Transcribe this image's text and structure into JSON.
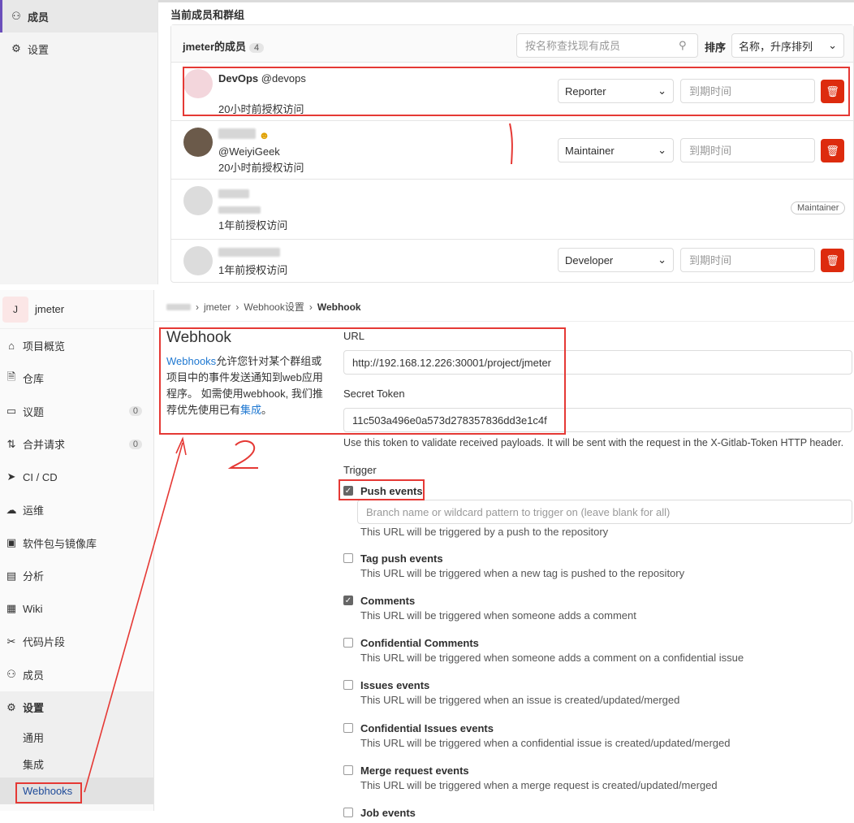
{
  "top_sidebar": {
    "items": [
      {
        "label": "成员",
        "icon": "users-icon",
        "active": true
      },
      {
        "label": "设置",
        "icon": "gear-icon",
        "active": false
      }
    ]
  },
  "members": {
    "section_title": "当前成员和群组",
    "header_title": "jmeter的成员",
    "count": "4",
    "search_placeholder": "按名称查找现有成员",
    "sort_label": "排序",
    "sort_value": "名称，升序排列",
    "expire_placeholder": "到期时间",
    "rows": [
      {
        "name": "DevOps",
        "handle": "@devops",
        "granted": "20小时前授权访问",
        "role": "Reporter"
      },
      {
        "name": "",
        "handle": "@WeiyiGeek",
        "granted": "20小时前授权访问",
        "role": "Maintainer"
      },
      {
        "name": "",
        "handle": "",
        "granted": "1年前授权访问",
        "role": "Maintainer"
      },
      {
        "name": "",
        "handle": "",
        "granted": "1年前授权访问",
        "role": "Developer"
      }
    ]
  },
  "project": {
    "avatar_letter": "J",
    "name": "jmeter"
  },
  "sidebar": {
    "items": [
      {
        "label": "项目概览",
        "icon": "home-icon"
      },
      {
        "label": "仓库",
        "icon": "document-icon"
      },
      {
        "label": "议题",
        "icon": "issues-icon",
        "badge": "0"
      },
      {
        "label": "合并请求",
        "icon": "merge-request-icon",
        "badge": "0"
      },
      {
        "label": "CI / CD",
        "icon": "rocket-icon"
      },
      {
        "label": "运维",
        "icon": "cloud-icon"
      },
      {
        "label": "软件包与镜像库",
        "icon": "package-icon"
      },
      {
        "label": "分析",
        "icon": "chart-icon"
      },
      {
        "label": "Wiki",
        "icon": "book-icon"
      },
      {
        "label": "代码片段",
        "icon": "scissors-icon"
      },
      {
        "label": "成员",
        "icon": "users-icon"
      },
      {
        "label": "设置",
        "icon": "gear-icon",
        "active": true
      }
    ],
    "settings_sub": [
      {
        "label": "通用"
      },
      {
        "label": "集成"
      },
      {
        "label": "Webhooks",
        "active": true
      }
    ]
  },
  "breadcrumb": {
    "items": [
      "jmeter",
      "Webhook设置"
    ],
    "current": "Webhook"
  },
  "webhook": {
    "title": "Webhook",
    "desc_link": "Webhooks",
    "desc_text": "允许您针对某个群组或项目中的事件发送通知到web应用程序。 如需使用webhook, 我们推荐优先使用已有",
    "desc_link2": "集成",
    "desc_end": "。",
    "url_label": "URL",
    "url_value": "http://192.168.12.226:30001/project/jmeter",
    "token_label": "Secret Token",
    "token_value": "11c503a496e0a573d278357836dd3e1c4f",
    "token_help": "Use this token to validate received payloads. It will be sent with the request in the X-Gitlab-Token HTTP header.",
    "trigger_label": "Trigger",
    "branch_placeholder": "Branch name or wildcard pattern to trigger on (leave blank for all)",
    "triggers": [
      {
        "label": "Push events",
        "help": "This URL will be triggered by a push to the repository",
        "checked": true
      },
      {
        "label": "Tag push events",
        "help": "This URL will be triggered when a new tag is pushed to the repository",
        "checked": false
      },
      {
        "label": "Comments",
        "help": "This URL will be triggered when someone adds a comment",
        "checked": true
      },
      {
        "label": "Confidential Comments",
        "help": "This URL will be triggered when someone adds a comment on a confidential issue",
        "checked": false
      },
      {
        "label": "Issues events",
        "help": "This URL will be triggered when an issue is created/updated/merged",
        "checked": false
      },
      {
        "label": "Confidential Issues events",
        "help": "This URL will be triggered when a confidential issue is created/updated/merged",
        "checked": false
      },
      {
        "label": "Merge request events",
        "help": "This URL will be triggered when a merge request is created/updated/merged",
        "checked": false
      },
      {
        "label": "Job events",
        "help": "",
        "checked": false
      }
    ]
  },
  "annotations": {
    "num_1": "1",
    "num_2": "2",
    "color": "#e53935"
  }
}
